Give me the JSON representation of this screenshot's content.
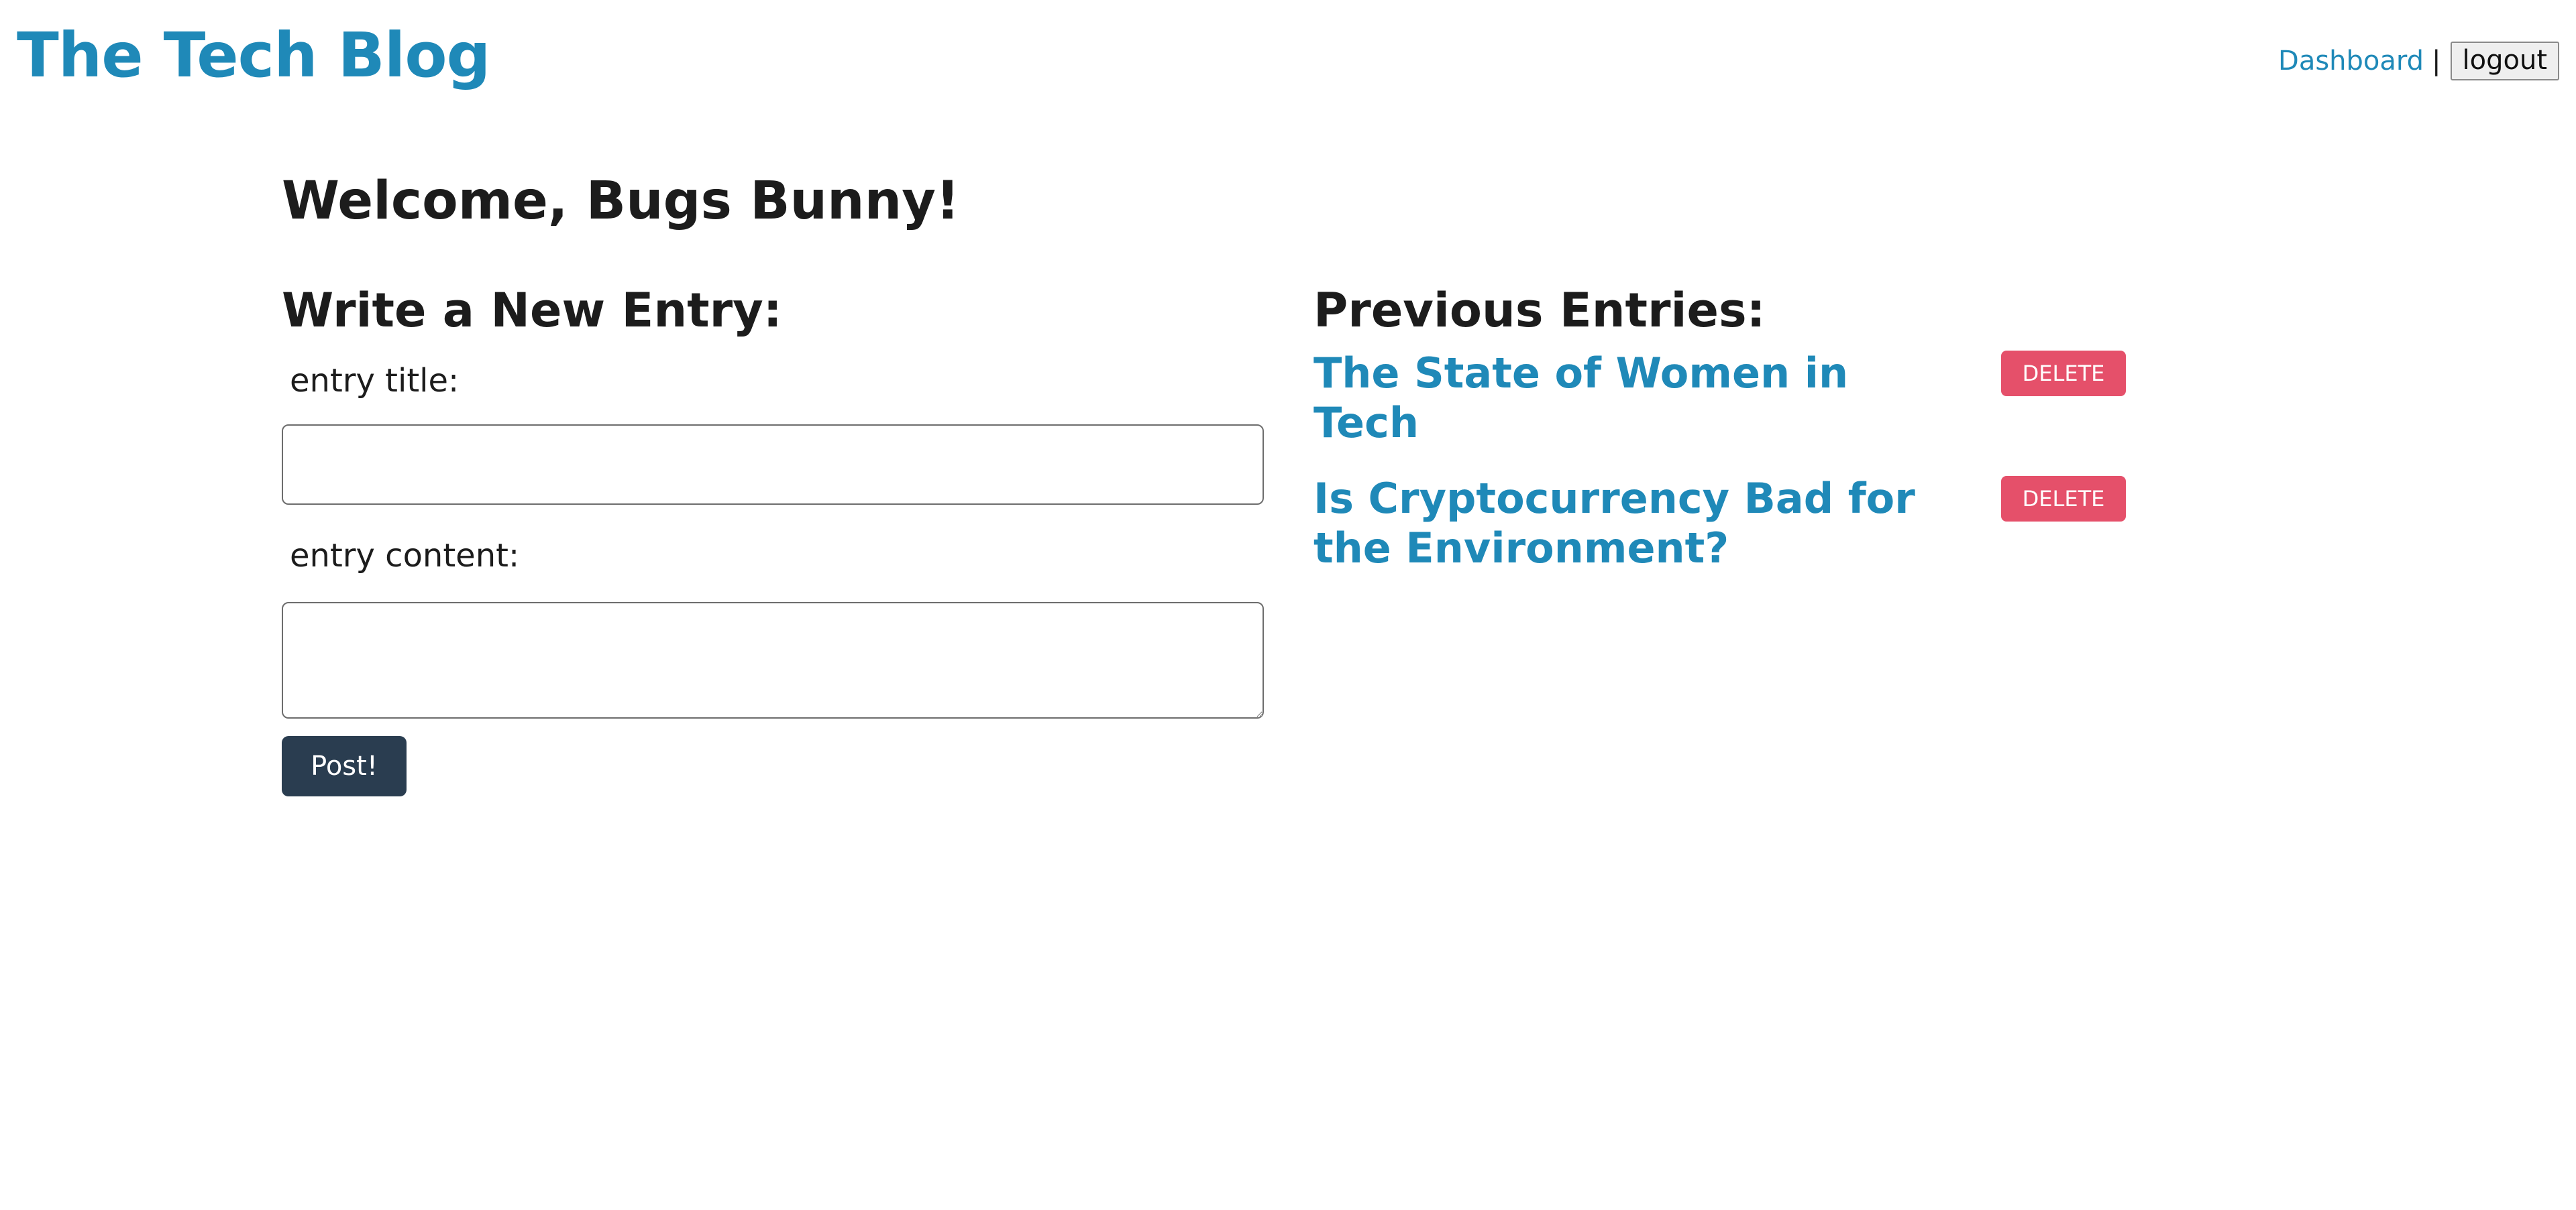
{
  "header": {
    "site_title": "The Tech Blog",
    "nav": {
      "dashboard_label": "Dashboard",
      "separator": "|",
      "logout_label": "logout"
    }
  },
  "main": {
    "welcome_text": "Welcome, Bugs Bunny!",
    "new_entry": {
      "heading": "Write a New Entry:",
      "title_label": "entry title:",
      "title_value": "",
      "content_label": "entry content:",
      "content_value": "",
      "post_label": "Post!"
    },
    "previous_entries": {
      "heading": "Previous Entries:",
      "items": [
        {
          "title": "The State of Women in Tech",
          "delete_label": "DELETE"
        },
        {
          "title": "Is Cryptocurrency Bad for the Environment?",
          "delete_label": "DELETE"
        }
      ]
    }
  },
  "colors": {
    "brand_blue": "#1f89b8",
    "post_button": "#2a3d50",
    "delete_button": "#e5506a",
    "text": "#1c1c1c"
  }
}
